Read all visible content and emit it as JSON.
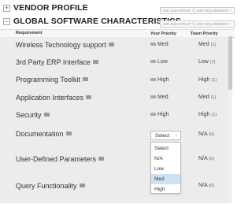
{
  "vendor_profile": {
    "title": "VENDOR PROFILE",
    "toggle": "+",
    "add_subgroup": "ADD SUB-GROUP +",
    "add_requirement": "ADD REQUIREMENT +"
  },
  "global_software": {
    "title": "GLOBAL SOFTWARE CHARACTERISTICS",
    "toggle": "−",
    "add_subgroup": "ADD SUB-GROUP +",
    "add_requirement": "ADD REQUIREMENT +"
  },
  "columns": {
    "requirement": "Requirement",
    "your_priority": "Your Priority",
    "team_priority": "Team Priority",
    "sort_glyph": "↕"
  },
  "rows": [
    {
      "name": "Wireless Technology support",
      "your": "Med",
      "team": "Med",
      "count": "(1)"
    },
    {
      "name": "3rd Party ERP Interface",
      "your": "Low",
      "team": "Low",
      "count": "(1)"
    },
    {
      "name": "Programming Toolkit",
      "your": "High",
      "team": "High",
      "count": "(1)"
    },
    {
      "name": "Application Interfaces",
      "your": "Med",
      "team": "Med",
      "count": "(1)"
    },
    {
      "name": "Security",
      "your": "High",
      "team": "High",
      "count": "(1)"
    },
    {
      "name": "Documentation",
      "your": "",
      "team": "N/A",
      "count": "(0)"
    },
    {
      "name": "User-Defined Parameters",
      "your": "",
      "team": "N/A",
      "count": "(0)"
    },
    {
      "name": "Query Functionality",
      "your": "",
      "team": "N/A",
      "count": "(0)"
    }
  ],
  "select": {
    "value": "Select",
    "chevron": "⌄"
  },
  "dropdown_options": [
    "Select",
    "N/A",
    "Low",
    "Med",
    "High"
  ],
  "dropdown_selected_index": 3,
  "colors": {
    "row_gray": "#ececec",
    "highlight": "#cde3f5"
  }
}
